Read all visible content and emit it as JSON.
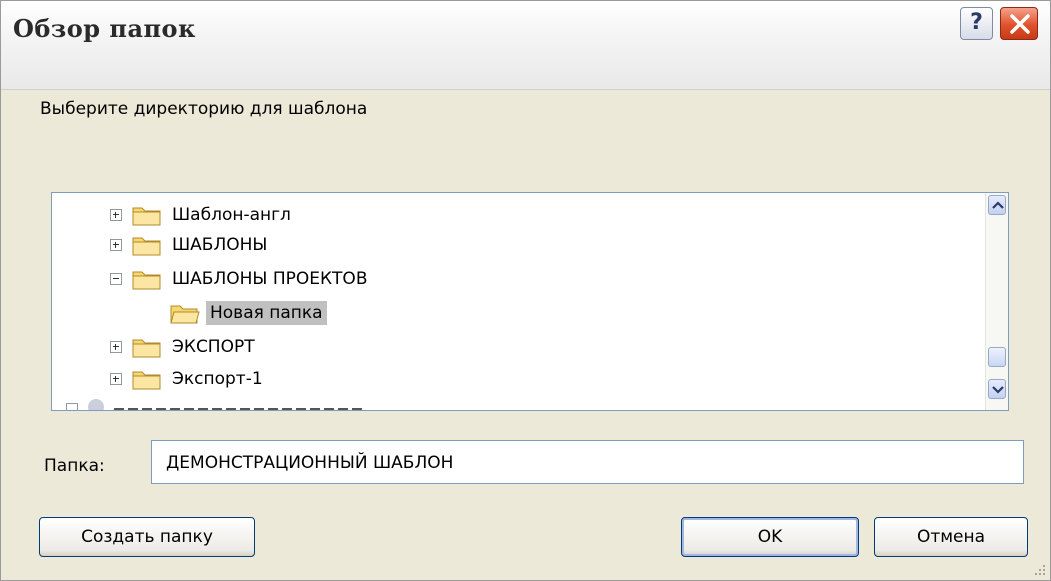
{
  "dialog": {
    "title": "Обзор папок",
    "help_label": "?",
    "prompt": "Выберите директорию для шаблона"
  },
  "tree": {
    "items": [
      {
        "label": "Шаблон-англ",
        "expander": "plus"
      },
      {
        "label": "ШАБЛОНЫ",
        "expander": "plus"
      },
      {
        "label": "ШАБЛОНЫ ПРОЕКТОВ",
        "expander": "minus"
      },
      {
        "label": "Новая папка",
        "expander": "none",
        "selected": true
      },
      {
        "label": "ЭКСПОРТ",
        "expander": "plus"
      },
      {
        "label": "Экспорт-1",
        "expander": "plus"
      }
    ]
  },
  "folder_field": {
    "label": "Папка:",
    "value": "ДЕМОНСТРАЦИОННЫЙ ШАБЛОН"
  },
  "buttons": {
    "create_folder": "Создать папку",
    "ok": "OK",
    "cancel": "Отмена"
  },
  "colors": {
    "dialog_bg": "#ece9d8",
    "selection_bg": "#c0c0c0",
    "close_red": "#e0522d",
    "folder_yellow": "#f8d76d"
  }
}
